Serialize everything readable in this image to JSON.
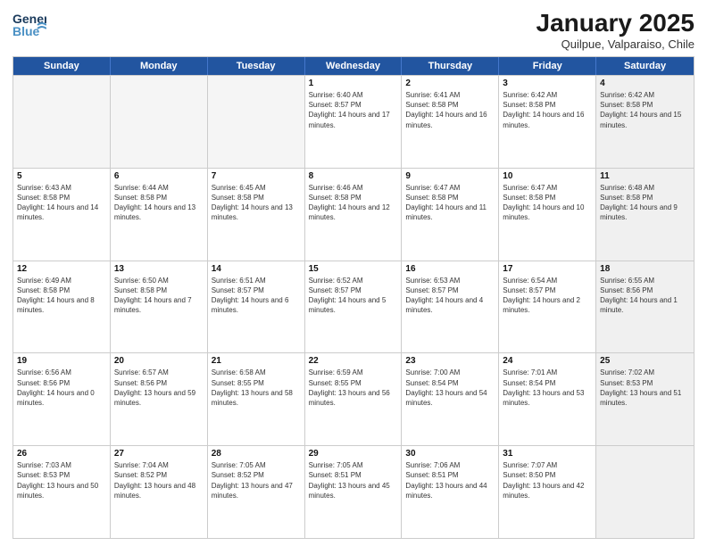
{
  "header": {
    "logo_general": "General",
    "logo_blue": "Blue",
    "title": "January 2025",
    "location": "Quilpue, Valparaiso, Chile"
  },
  "weekdays": [
    "Sunday",
    "Monday",
    "Tuesday",
    "Wednesday",
    "Thursday",
    "Friday",
    "Saturday"
  ],
  "rows": [
    [
      {
        "day": "",
        "empty": true
      },
      {
        "day": "",
        "empty": true
      },
      {
        "day": "",
        "empty": true
      },
      {
        "day": "1",
        "sunrise": "Sunrise: 6:40 AM",
        "sunset": "Sunset: 8:57 PM",
        "daylight": "Daylight: 14 hours and 17 minutes."
      },
      {
        "day": "2",
        "sunrise": "Sunrise: 6:41 AM",
        "sunset": "Sunset: 8:58 PM",
        "daylight": "Daylight: 14 hours and 16 minutes."
      },
      {
        "day": "3",
        "sunrise": "Sunrise: 6:42 AM",
        "sunset": "Sunset: 8:58 PM",
        "daylight": "Daylight: 14 hours and 16 minutes."
      },
      {
        "day": "4",
        "sunrise": "Sunrise: 6:42 AM",
        "sunset": "Sunset: 8:58 PM",
        "daylight": "Daylight: 14 hours and 15 minutes.",
        "shaded": true
      }
    ],
    [
      {
        "day": "5",
        "sunrise": "Sunrise: 6:43 AM",
        "sunset": "Sunset: 8:58 PM",
        "daylight": "Daylight: 14 hours and 14 minutes."
      },
      {
        "day": "6",
        "sunrise": "Sunrise: 6:44 AM",
        "sunset": "Sunset: 8:58 PM",
        "daylight": "Daylight: 14 hours and 13 minutes."
      },
      {
        "day": "7",
        "sunrise": "Sunrise: 6:45 AM",
        "sunset": "Sunset: 8:58 PM",
        "daylight": "Daylight: 14 hours and 13 minutes."
      },
      {
        "day": "8",
        "sunrise": "Sunrise: 6:46 AM",
        "sunset": "Sunset: 8:58 PM",
        "daylight": "Daylight: 14 hours and 12 minutes."
      },
      {
        "day": "9",
        "sunrise": "Sunrise: 6:47 AM",
        "sunset": "Sunset: 8:58 PM",
        "daylight": "Daylight: 14 hours and 11 minutes."
      },
      {
        "day": "10",
        "sunrise": "Sunrise: 6:47 AM",
        "sunset": "Sunset: 8:58 PM",
        "daylight": "Daylight: 14 hours and 10 minutes."
      },
      {
        "day": "11",
        "sunrise": "Sunrise: 6:48 AM",
        "sunset": "Sunset: 8:58 PM",
        "daylight": "Daylight: 14 hours and 9 minutes.",
        "shaded": true
      }
    ],
    [
      {
        "day": "12",
        "sunrise": "Sunrise: 6:49 AM",
        "sunset": "Sunset: 8:58 PM",
        "daylight": "Daylight: 14 hours and 8 minutes."
      },
      {
        "day": "13",
        "sunrise": "Sunrise: 6:50 AM",
        "sunset": "Sunset: 8:58 PM",
        "daylight": "Daylight: 14 hours and 7 minutes."
      },
      {
        "day": "14",
        "sunrise": "Sunrise: 6:51 AM",
        "sunset": "Sunset: 8:57 PM",
        "daylight": "Daylight: 14 hours and 6 minutes."
      },
      {
        "day": "15",
        "sunrise": "Sunrise: 6:52 AM",
        "sunset": "Sunset: 8:57 PM",
        "daylight": "Daylight: 14 hours and 5 minutes."
      },
      {
        "day": "16",
        "sunrise": "Sunrise: 6:53 AM",
        "sunset": "Sunset: 8:57 PM",
        "daylight": "Daylight: 14 hours and 4 minutes."
      },
      {
        "day": "17",
        "sunrise": "Sunrise: 6:54 AM",
        "sunset": "Sunset: 8:57 PM",
        "daylight": "Daylight: 14 hours and 2 minutes."
      },
      {
        "day": "18",
        "sunrise": "Sunrise: 6:55 AM",
        "sunset": "Sunset: 8:56 PM",
        "daylight": "Daylight: 14 hours and 1 minute.",
        "shaded": true
      }
    ],
    [
      {
        "day": "19",
        "sunrise": "Sunrise: 6:56 AM",
        "sunset": "Sunset: 8:56 PM",
        "daylight": "Daylight: 14 hours and 0 minutes."
      },
      {
        "day": "20",
        "sunrise": "Sunrise: 6:57 AM",
        "sunset": "Sunset: 8:56 PM",
        "daylight": "Daylight: 13 hours and 59 minutes."
      },
      {
        "day": "21",
        "sunrise": "Sunrise: 6:58 AM",
        "sunset": "Sunset: 8:55 PM",
        "daylight": "Daylight: 13 hours and 58 minutes."
      },
      {
        "day": "22",
        "sunrise": "Sunrise: 6:59 AM",
        "sunset": "Sunset: 8:55 PM",
        "daylight": "Daylight: 13 hours and 56 minutes."
      },
      {
        "day": "23",
        "sunrise": "Sunrise: 7:00 AM",
        "sunset": "Sunset: 8:54 PM",
        "daylight": "Daylight: 13 hours and 54 minutes."
      },
      {
        "day": "24",
        "sunrise": "Sunrise: 7:01 AM",
        "sunset": "Sunset: 8:54 PM",
        "daylight": "Daylight: 13 hours and 53 minutes."
      },
      {
        "day": "25",
        "sunrise": "Sunrise: 7:02 AM",
        "sunset": "Sunset: 8:53 PM",
        "daylight": "Daylight: 13 hours and 51 minutes.",
        "shaded": true
      }
    ],
    [
      {
        "day": "26",
        "sunrise": "Sunrise: 7:03 AM",
        "sunset": "Sunset: 8:53 PM",
        "daylight": "Daylight: 13 hours and 50 minutes."
      },
      {
        "day": "27",
        "sunrise": "Sunrise: 7:04 AM",
        "sunset": "Sunset: 8:52 PM",
        "daylight": "Daylight: 13 hours and 48 minutes."
      },
      {
        "day": "28",
        "sunrise": "Sunrise: 7:05 AM",
        "sunset": "Sunset: 8:52 PM",
        "daylight": "Daylight: 13 hours and 47 minutes."
      },
      {
        "day": "29",
        "sunrise": "Sunrise: 7:05 AM",
        "sunset": "Sunset: 8:51 PM",
        "daylight": "Daylight: 13 hours and 45 minutes."
      },
      {
        "day": "30",
        "sunrise": "Sunrise: 7:06 AM",
        "sunset": "Sunset: 8:51 PM",
        "daylight": "Daylight: 13 hours and 44 minutes."
      },
      {
        "day": "31",
        "sunrise": "Sunrise: 7:07 AM",
        "sunset": "Sunset: 8:50 PM",
        "daylight": "Daylight: 13 hours and 42 minutes."
      },
      {
        "day": "",
        "empty": true,
        "shaded": true
      }
    ]
  ]
}
